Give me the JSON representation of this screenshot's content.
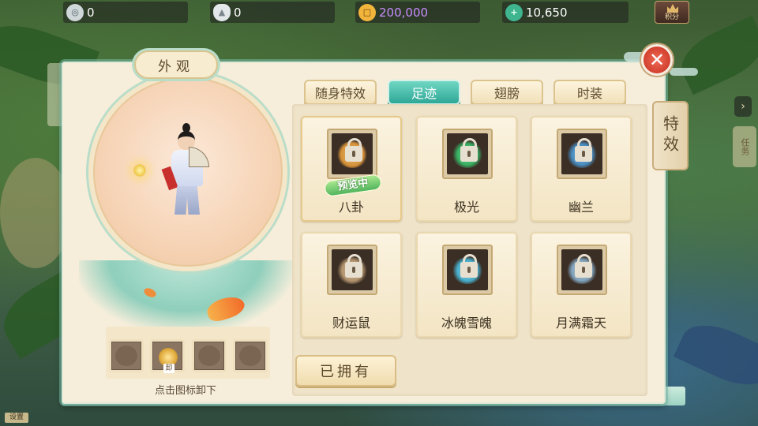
{
  "currencies": [
    {
      "icon": "silver-coin-icon",
      "value": "0"
    },
    {
      "icon": "silver-ingot-icon",
      "value": "0"
    },
    {
      "icon": "copper-coin-icon",
      "value": "200,000",
      "color": "#c98cff"
    },
    {
      "icon": "jade-icon",
      "value": "10,650"
    }
  ],
  "score_button": {
    "label": "积分"
  },
  "side": {
    "left_text": "包\n装",
    "task_tab": "任务",
    "bottom_chip": "设置"
  },
  "panel": {
    "title": "外观",
    "side_tab": "特效",
    "close_label": "✕"
  },
  "tabs": [
    {
      "label": "随身特效",
      "active": false
    },
    {
      "label": "足迹",
      "active": true
    },
    {
      "label": "翅膀",
      "active": false
    },
    {
      "label": "时装",
      "active": false
    }
  ],
  "cards": [
    {
      "name": "八卦",
      "locked": true,
      "preview": true,
      "glow": "#f0a23c"
    },
    {
      "name": "极光",
      "locked": true,
      "preview": false,
      "glow": "#37c46c"
    },
    {
      "name": "幽兰",
      "locked": true,
      "preview": false,
      "glow": "#4a9ad8"
    },
    {
      "name": "财运鼠",
      "locked": true,
      "preview": false,
      "glow": "#c7a57a"
    },
    {
      "name": "冰魄雪魄",
      "locked": true,
      "preview": false,
      "glow": "#49c3e8"
    },
    {
      "name": "月满霜天",
      "locked": true,
      "preview": false,
      "glow": "#8bb6d6"
    }
  ],
  "preview_badge": "预览中",
  "slots": {
    "unload_mark": "卸",
    "hint": "点击图标卸下"
  },
  "owned_button": "已拥有"
}
